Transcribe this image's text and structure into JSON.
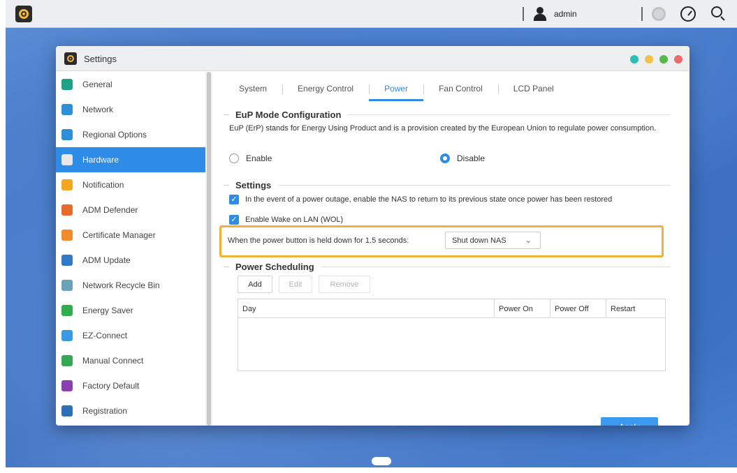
{
  "topbar": {
    "user_name": "admin"
  },
  "window": {
    "title": "Settings",
    "dot_colors": [
      "#2bbfb3",
      "#f4c24a",
      "#55b84a",
      "#ef6a6a"
    ]
  },
  "sidebar": {
    "items": [
      {
        "label": "General",
        "icon": "general-icon",
        "color": "#1fa187"
      },
      {
        "label": "Network",
        "icon": "globe-icon",
        "color": "#2d8fd6"
      },
      {
        "label": "Regional Options",
        "icon": "regional-icon",
        "color": "#2d8fd6"
      },
      {
        "label": "Hardware",
        "icon": "hardware-icon",
        "color": "#e8e8e8",
        "active": true
      },
      {
        "label": "Notification",
        "icon": "notification-icon",
        "color": "#f4a623"
      },
      {
        "label": "ADM Defender",
        "icon": "defender-icon",
        "color": "#e86a2a"
      },
      {
        "label": "Certificate Manager",
        "icon": "certificate-icon",
        "color": "#f08a2c"
      },
      {
        "label": "ADM Update",
        "icon": "update-icon",
        "color": "#3178c6"
      },
      {
        "label": "Network Recycle Bin",
        "icon": "recycle-bin-icon",
        "color": "#6aa3b8"
      },
      {
        "label": "Energy Saver",
        "icon": "energy-saver-icon",
        "color": "#2fae4a"
      },
      {
        "label": "EZ-Connect",
        "icon": "cloud-icon",
        "color": "#3a9ae0"
      },
      {
        "label": "Manual Connect",
        "icon": "manual-connect-icon",
        "color": "#35a853"
      },
      {
        "label": "Factory Default",
        "icon": "factory-default-icon",
        "color": "#8b3fb0"
      },
      {
        "label": "Registration",
        "icon": "registration-icon",
        "color": "#2d6fb8"
      }
    ]
  },
  "tabs": [
    {
      "label": "System"
    },
    {
      "label": "Energy Control"
    },
    {
      "label": "Power",
      "active": true
    },
    {
      "label": "Fan Control"
    },
    {
      "label": "LCD Panel"
    }
  ],
  "eup": {
    "heading": "EuP Mode Configuration",
    "description": "EuP (ErP) stands for Energy Using Product and is a provision created by the European Union to regulate power consumption.",
    "enable_label": "Enable",
    "disable_label": "Disable"
  },
  "settings": {
    "heading": "Settings",
    "power_restore_label": "In the event of a power outage, enable the NAS to return to its previous state once power has been restored",
    "wol_label": "Enable Wake on LAN (WOL)",
    "power_button_label": "When the power button is held down for 1.5 seconds:",
    "power_button_value": "Shut down NAS"
  },
  "scheduling": {
    "heading": "Power Scheduling",
    "add_label": "Add",
    "edit_label": "Edit",
    "remove_label": "Remove",
    "columns": [
      "Day",
      "Power On",
      "Power Off",
      "Restart"
    ]
  },
  "footer": {
    "apply_label": "Apply"
  }
}
